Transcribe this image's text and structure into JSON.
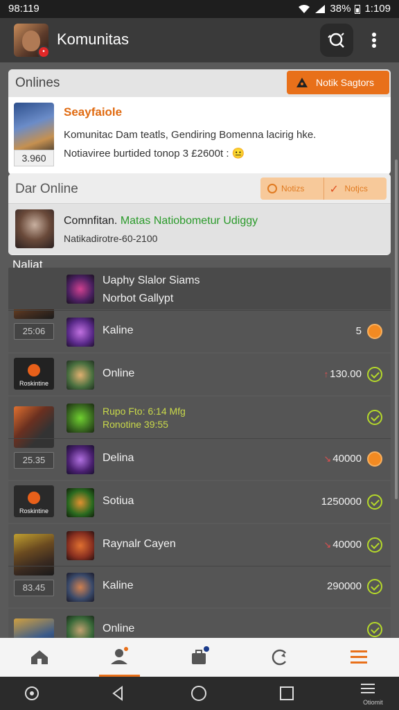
{
  "status_bar": {
    "time": "98:119",
    "battery": "38%",
    "clock": "1:109"
  },
  "app_bar": {
    "title": "Komunitas",
    "icons": [
      "search-icon",
      "more-vert-icon"
    ]
  },
  "onlines_card": {
    "label": "Onlines",
    "action_label": "Notik Sagtors",
    "item": {
      "thumb_tag": "3.960",
      "name": "Seayfaiole",
      "line1": "Komunitac Dam teatls, Gendiring Bomenna lacirig hke.",
      "line2": "Notiaviree burtided tonop 3 £2600t : 😐"
    }
  },
  "online_card": {
    "label": "Dar Online",
    "segments": [
      "Notizs",
      "Notjcs"
    ],
    "item": {
      "line1_main": "Comnfitan. ",
      "line1_green": "Matas Natiobometur Udiggy",
      "line2": "Natikadirotre-60-2100"
    }
  },
  "list_section": {
    "label": "Naliat",
    "groups": [
      {
        "tag": "25:06",
        "items": [
          {
            "name_line1": "Uaphy Slalor Siams",
            "name_line2": "Norbot Gallypt"
          },
          {
            "name": "Kaline",
            "value": "5",
            "indicator": "orange"
          }
        ]
      },
      {
        "thumb_label": "Roskintine",
        "items": [
          {
            "name": "Online",
            "value_mark": "↑",
            "value": "130.00",
            "indicator": "green"
          }
        ]
      },
      {
        "tag": "25.35",
        "items": [
          {
            "name_line1": "Rupo Fto: 6:14 Mfg",
            "name_line2": "Ronotine 39:55",
            "indicator": "green"
          },
          {
            "name": "Delina",
            "value_mark": "↘",
            "value": "40000",
            "indicator": "orange"
          }
        ]
      },
      {
        "thumb_label": "Roskintine",
        "items": [
          {
            "name": "Sotiua",
            "value": "1250000",
            "indicator": "green"
          }
        ]
      },
      {
        "tag": "83.45",
        "items": [
          {
            "name": "Raynalr Cayen",
            "value_mark": "↘",
            "value": "40000",
            "indicator": "green"
          },
          {
            "name": "Kaline",
            "value": "290000",
            "indicator": "green"
          }
        ]
      },
      {
        "items": [
          {
            "name": "Online",
            "indicator": "green"
          }
        ]
      }
    ]
  },
  "bottom_nav": {
    "items": [
      "home-icon",
      "user-add-icon",
      "briefcase-icon",
      "refresh-icon",
      "menu-icon"
    ],
    "active_index": 1,
    "accent": "#e8701a"
  },
  "system_nav": {
    "items": [
      "settings-icon",
      "back-icon",
      "home-circle-icon",
      "recents-icon",
      "overview-icon"
    ],
    "last_caption": "Otiomit"
  }
}
